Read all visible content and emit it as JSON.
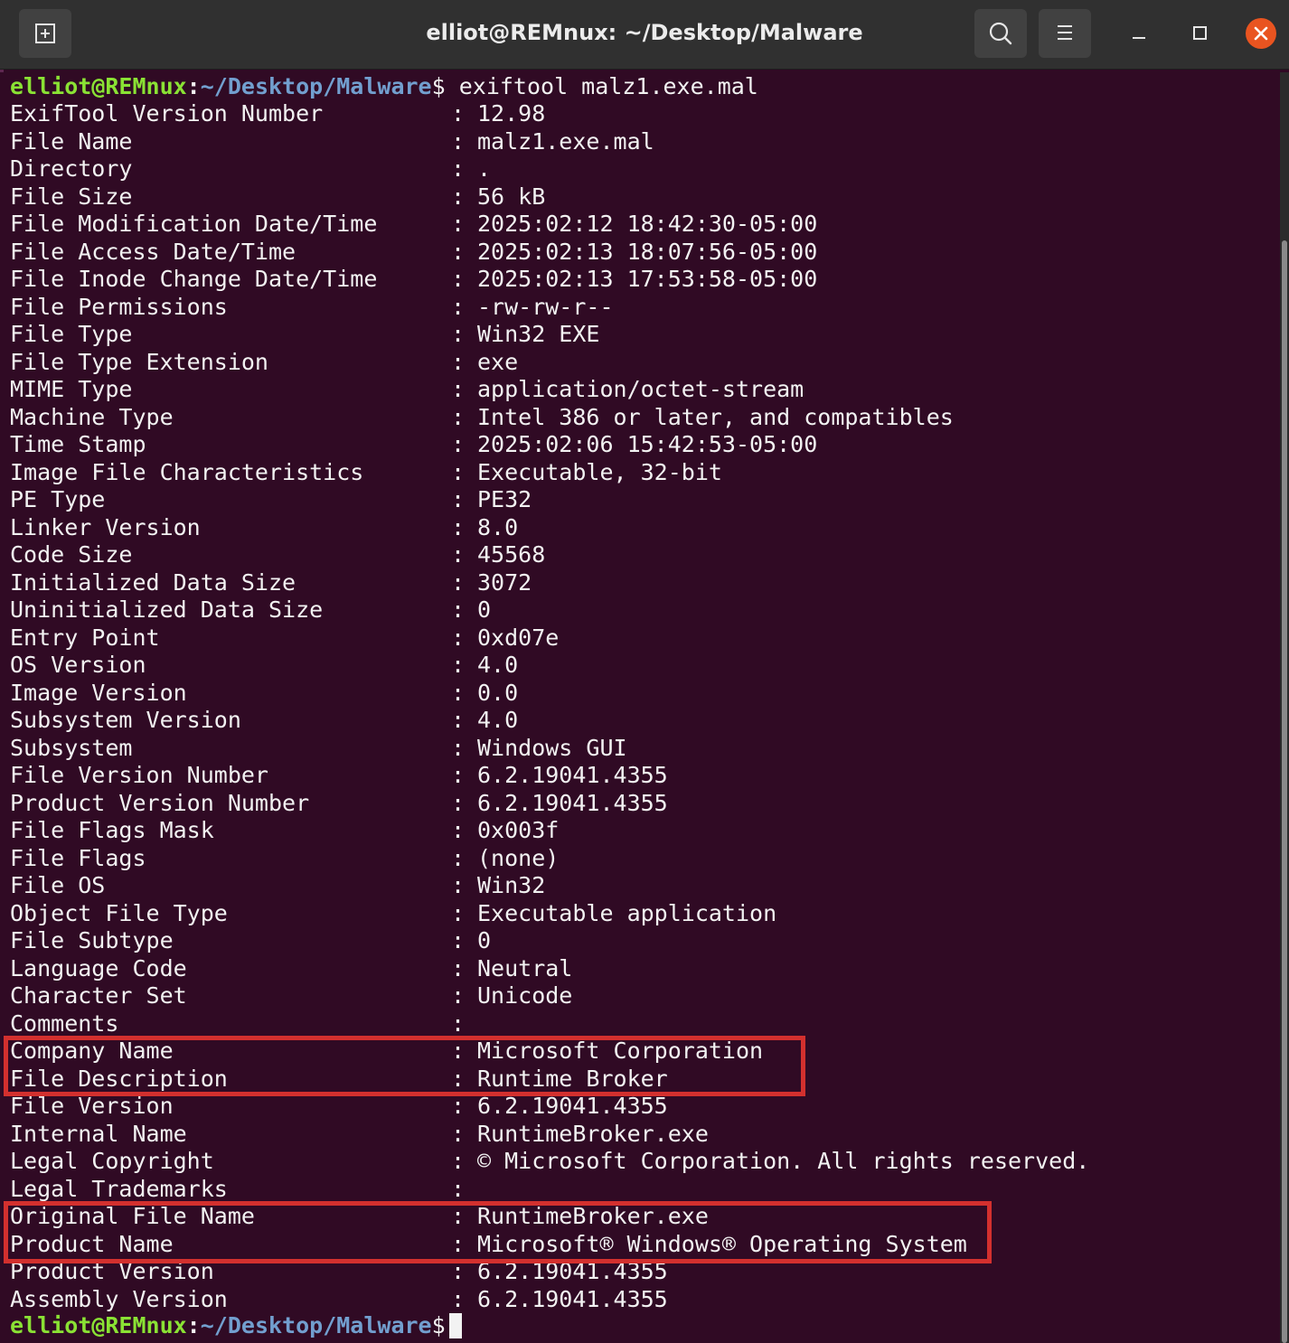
{
  "window": {
    "title": "elliot@REMnux: ~/Desktop/Malware"
  },
  "titlebar_buttons": {
    "new_tab_icon": "new-tab-icon",
    "search_icon": "search-icon",
    "menu_icon": "hamburger-menu-icon",
    "minimize_icon": "minimize-icon",
    "maximize_icon": "maximize-icon",
    "close_icon": "close-icon"
  },
  "colors": {
    "terminal_bg": "#300a24",
    "prompt_user": "#8ae234",
    "prompt_path": "#729fcf",
    "highlight": "#d3302e",
    "close_button": "#e95420"
  },
  "prompt": {
    "user_host": "elliot@REMnux",
    "colon": ":",
    "path": "~/Desktop/Malware",
    "dollar": "$",
    "command": " exiftool malz1.exe.mal"
  },
  "separator": ":",
  "rows": [
    {
      "label": "ExifTool Version Number",
      "value": "12.98"
    },
    {
      "label": "File Name",
      "value": "malz1.exe.mal"
    },
    {
      "label": "Directory",
      "value": "."
    },
    {
      "label": "File Size",
      "value": "56 kB"
    },
    {
      "label": "File Modification Date/Time",
      "value": "2025:02:12 18:42:30-05:00"
    },
    {
      "label": "File Access Date/Time",
      "value": "2025:02:13 18:07:56-05:00"
    },
    {
      "label": "File Inode Change Date/Time",
      "value": "2025:02:13 17:53:58-05:00"
    },
    {
      "label": "File Permissions",
      "value": "-rw-rw-r--"
    },
    {
      "label": "File Type",
      "value": "Win32 EXE"
    },
    {
      "label": "File Type Extension",
      "value": "exe"
    },
    {
      "label": "MIME Type",
      "value": "application/octet-stream"
    },
    {
      "label": "Machine Type",
      "value": "Intel 386 or later, and compatibles"
    },
    {
      "label": "Time Stamp",
      "value": "2025:02:06 15:42:53-05:00"
    },
    {
      "label": "Image File Characteristics",
      "value": "Executable, 32-bit"
    },
    {
      "label": "PE Type",
      "value": "PE32"
    },
    {
      "label": "Linker Version",
      "value": "8.0"
    },
    {
      "label": "Code Size",
      "value": "45568"
    },
    {
      "label": "Initialized Data Size",
      "value": "3072"
    },
    {
      "label": "Uninitialized Data Size",
      "value": "0"
    },
    {
      "label": "Entry Point",
      "value": "0xd07e"
    },
    {
      "label": "OS Version",
      "value": "4.0"
    },
    {
      "label": "Image Version",
      "value": "0.0"
    },
    {
      "label": "Subsystem Version",
      "value": "4.0"
    },
    {
      "label": "Subsystem",
      "value": "Windows GUI"
    },
    {
      "label": "File Version Number",
      "value": "6.2.19041.4355"
    },
    {
      "label": "Product Version Number",
      "value": "6.2.19041.4355"
    },
    {
      "label": "File Flags Mask",
      "value": "0x003f"
    },
    {
      "label": "File Flags",
      "value": "(none)"
    },
    {
      "label": "File OS",
      "value": "Win32"
    },
    {
      "label": "Object File Type",
      "value": "Executable application"
    },
    {
      "label": "File Subtype",
      "value": "0"
    },
    {
      "label": "Language Code",
      "value": "Neutral"
    },
    {
      "label": "Character Set",
      "value": "Unicode"
    },
    {
      "label": "Comments",
      "value": ""
    },
    {
      "label": "Company Name",
      "value": "Microsoft Corporation"
    },
    {
      "label": "File Description",
      "value": "Runtime Broker"
    },
    {
      "label": "File Version",
      "value": "6.2.19041.4355"
    },
    {
      "label": "Internal Name",
      "value": "RuntimeBroker.exe"
    },
    {
      "label": "Legal Copyright",
      "value": "© Microsoft Corporation. All rights reserved."
    },
    {
      "label": "Legal Trademarks",
      "value": ""
    },
    {
      "label": "Original File Name",
      "value": "RuntimeBroker.exe"
    },
    {
      "label": "Product Name",
      "value": "Microsoft® Windows® Operating System"
    },
    {
      "label": "Product Version",
      "value": "6.2.19041.4355"
    },
    {
      "label": "Assembly Version",
      "value": "6.2.19041.4355"
    }
  ]
}
